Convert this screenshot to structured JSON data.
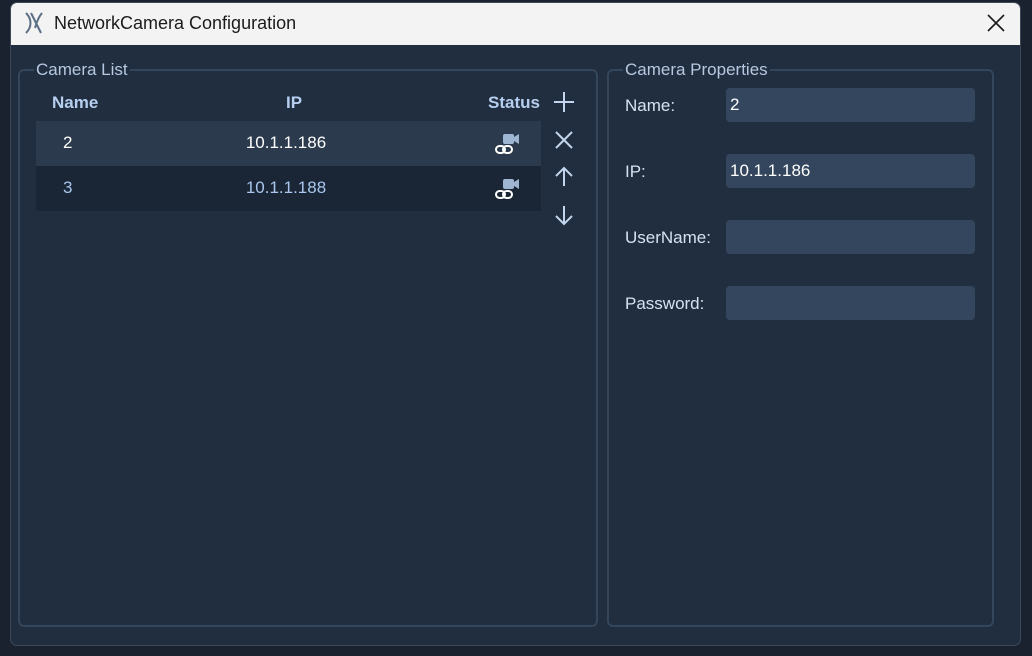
{
  "window": {
    "title": "NetworkCamera Configuration"
  },
  "camera_list": {
    "legend": "Camera List",
    "columns": {
      "name": "Name",
      "ip": "IP",
      "status": "Status"
    },
    "rows": [
      {
        "name": "2",
        "ip": "10.1.1.186",
        "status_icon": "camera-linked-icon"
      },
      {
        "name": "3",
        "ip": "10.1.1.188",
        "status_icon": "camera-linked-icon"
      }
    ],
    "actions": [
      "add-icon",
      "remove-icon",
      "move-up-icon",
      "move-down-icon"
    ]
  },
  "camera_properties": {
    "legend": "Camera Properties",
    "name_label": "Name:",
    "name_value": "2",
    "ip_label": "IP:",
    "ip_value": "10.1.1.186",
    "username_label": "UserName:",
    "username_value": "",
    "password_label": "Password:",
    "password_value": ""
  },
  "colors": {
    "background": "#212e3f",
    "selected_row": "#2b3a4c",
    "input_bg": "#33465d",
    "accent": "#b6cff0"
  }
}
